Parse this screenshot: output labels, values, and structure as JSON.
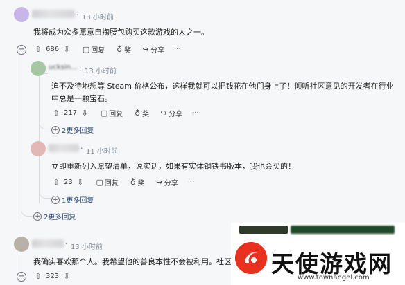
{
  "comments": [
    {
      "time": "13 小时前",
      "text": "我将成为众多愿意自掏腰包购买这款游戏的人之一。",
      "votes": "686",
      "reply": "回复",
      "award": "奖",
      "share": "分享"
    },
    {
      "user": "ucksin...",
      "time": "13 小时前",
      "text": "迫不及待地想等 Steam 价格公布，这样我就可以把钱花在他们身上了！倾听社区意见的开发者在行业中总是一颗宝石。",
      "votes": "217",
      "reply": "回复",
      "award": "奖",
      "share": "分享",
      "more": "2更多回复"
    },
    {
      "time": "11 小时前",
      "text": "立即重新列入愿望清单，说实话，如果有实体钢铁书版本，我也会买的！",
      "votes": "23",
      "reply": "回复",
      "award": "奖",
      "share": "分享",
      "more": "1更多回复"
    },
    {
      "more": "2更多回复"
    },
    {
      "time": "13 小时前",
      "text": "我确实喜欢那个人。我希望他的善良本性不会被利用。社区应",
      "votes": "323"
    }
  ],
  "watermark": {
    "title": "天使游戏网",
    "url": "www.townangel.com"
  },
  "icons": {
    "up": "arrow-up-icon",
    "down": "arrow-down-icon",
    "reply": "comment-icon",
    "award": "award-icon",
    "share": "share-icon"
  }
}
